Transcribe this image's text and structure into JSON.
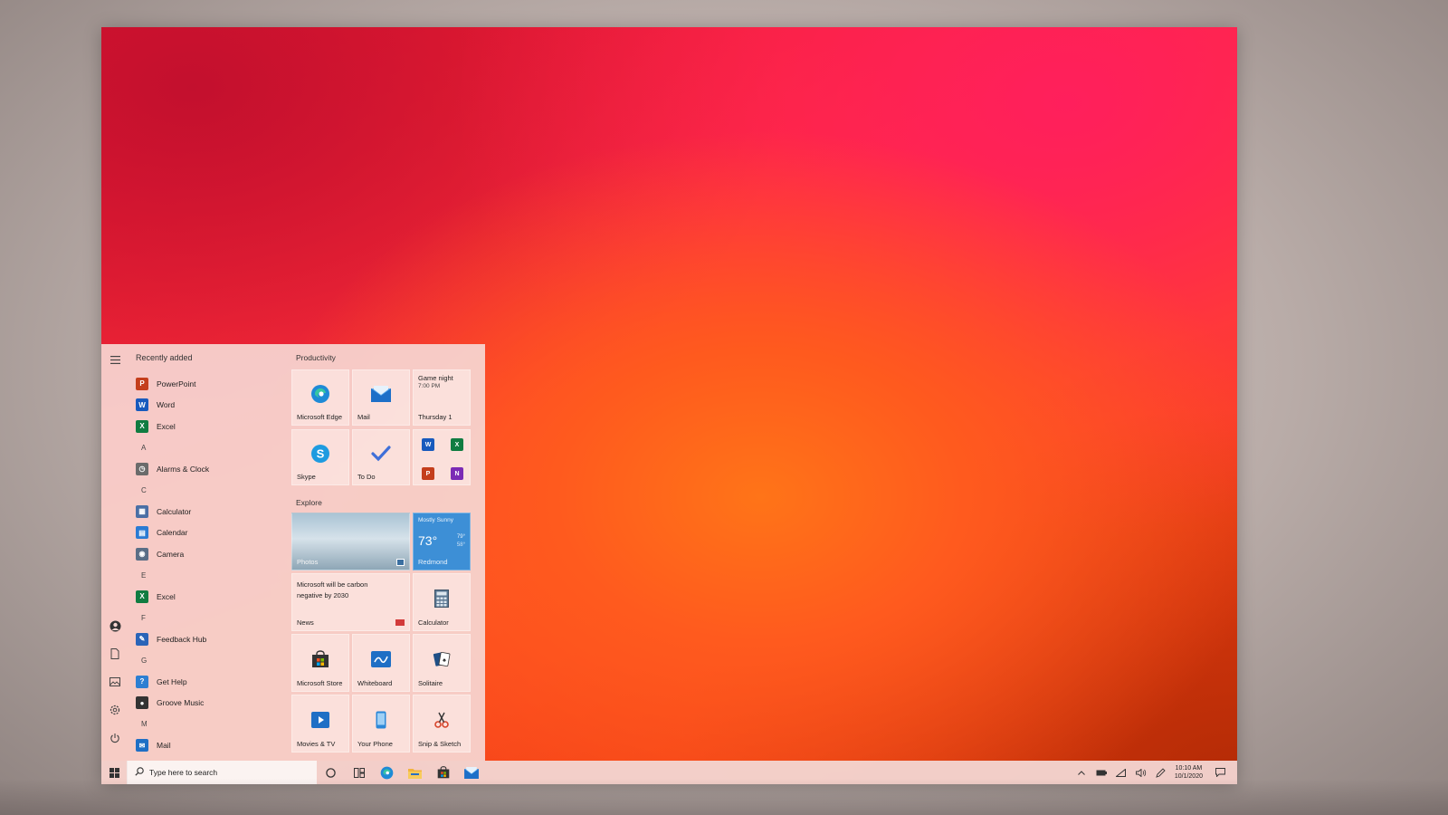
{
  "start_menu": {
    "app_list": {
      "header": "Recently added",
      "rows": [
        {
          "type": "app",
          "label": "PowerPoint",
          "icon": "powerpoint-icon",
          "color": "#c43e1c",
          "glyph": "P"
        },
        {
          "type": "app",
          "label": "Word",
          "icon": "word-icon",
          "color": "#185abd",
          "glyph": "W"
        },
        {
          "type": "app",
          "label": "Excel",
          "icon": "excel-icon",
          "color": "#107c41",
          "glyph": "X"
        },
        {
          "type": "letter",
          "label": "A"
        },
        {
          "type": "app",
          "label": "Alarms & Clock",
          "icon": "alarm-clock-icon",
          "color": "#6b6b6b",
          "glyph": "◷"
        },
        {
          "type": "letter",
          "label": "C"
        },
        {
          "type": "app",
          "label": "Calculator",
          "icon": "calculator-icon",
          "color": "#4a6fa5",
          "glyph": "▦"
        },
        {
          "type": "app",
          "label": "Calendar",
          "icon": "calendar-icon",
          "color": "#2b7bd3",
          "glyph": "▤"
        },
        {
          "type": "app",
          "label": "Camera",
          "icon": "camera-icon",
          "color": "#5a6e86",
          "glyph": "◉"
        },
        {
          "type": "letter",
          "label": "E"
        },
        {
          "type": "app",
          "label": "Excel",
          "icon": "excel-icon",
          "color": "#107c41",
          "glyph": "X"
        },
        {
          "type": "letter",
          "label": "F"
        },
        {
          "type": "app",
          "label": "Feedback Hub",
          "icon": "feedback-hub-icon",
          "color": "#2a64b8",
          "glyph": "✎"
        },
        {
          "type": "letter",
          "label": "G"
        },
        {
          "type": "app",
          "label": "Get Help",
          "icon": "get-help-icon",
          "color": "#2d7fd2",
          "glyph": "?"
        },
        {
          "type": "app",
          "label": "Groove Music",
          "icon": "groove-music-icon",
          "color": "#333333",
          "glyph": "●"
        },
        {
          "type": "letter",
          "label": "M"
        },
        {
          "type": "app",
          "label": "Mail",
          "icon": "mail-icon",
          "color": "#1f6fc5",
          "glyph": "✉"
        }
      ]
    },
    "groups": {
      "productivity": "Productivity",
      "explore": "Explore"
    },
    "tiles": {
      "edge": "Microsoft Edge",
      "mail": "Mail",
      "calendar_event": "Game night",
      "calendar_time": "7:00 PM",
      "calendar_day": "Thursday 1",
      "skype": "Skype",
      "todo": "To Do",
      "photos": "Photos",
      "weather_condition": "Mostly Sunny",
      "weather_temp": "73°",
      "weather_high": "79°",
      "weather_low": "58°",
      "weather_location": "Redmond",
      "news_headline": "Microsoft will be carbon negative by 2030",
      "news_label": "News",
      "calculator": "Calculator",
      "store": "Microsoft Store",
      "whiteboard": "Whiteboard",
      "solitaire": "Solitaire",
      "movies": "Movies & TV",
      "phone": "Your Phone",
      "snip": "Snip & Sketch"
    }
  },
  "taskbar": {
    "search_placeholder": "Type here to search",
    "time": "10:10 AM",
    "date": "10/1/2020"
  },
  "colors": {
    "accent_red": "#ff2f3a",
    "accent_orange": "#ff7418",
    "start_bg": "#f6d6d2",
    "weather_tile": "#3d8fd6"
  }
}
